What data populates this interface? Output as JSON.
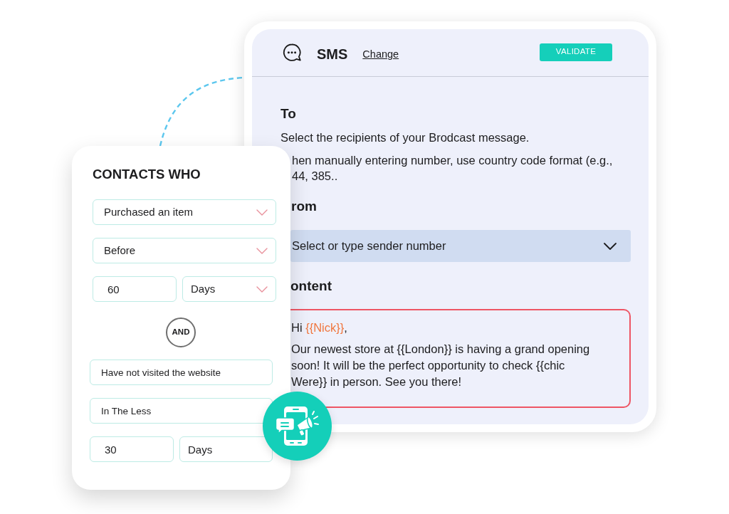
{
  "sms_panel": {
    "header": {
      "title": "SMS",
      "link": "Change",
      "button": "VALIDATE"
    },
    "to": {
      "heading": "To",
      "description": "Select the recipients of your Brodcast message.",
      "note": "hen manually entering number, use country code format (e.g., 44, 385.."
    },
    "from": {
      "heading": "rom",
      "sender_select": {
        "placeholder": "Select or type sender number"
      }
    },
    "content": {
      "heading": "ontent",
      "greeting": [
        {
          "kind": "text",
          "text": "Hi "
        },
        {
          "kind": "variable",
          "text": "{{Nick}}"
        },
        {
          "kind": "text",
          "text": ","
        }
      ],
      "body": "Our newest store at {{London}} is having a grand opening soon! It will be the perfect opportunity to check {{chic Were}} in person. See you there!"
    }
  },
  "contacts_card": {
    "title": "CONTACTS WHO",
    "condition_groups": [
      {
        "rows": [
          [
            {
              "kind": "dropdown",
              "value": "Purchased an item"
            }
          ],
          [
            {
              "kind": "dropdown",
              "value": "Before"
            }
          ],
          [
            {
              "kind": "field",
              "value": "60"
            },
            {
              "kind": "dropdown",
              "value": "Days"
            }
          ]
        ]
      },
      {
        "rows": [
          [
            {
              "kind": "field",
              "value": "Have not visited the website"
            }
          ],
          [
            {
              "kind": "field",
              "value": "In The Less"
            }
          ],
          [
            {
              "kind": "field",
              "value": "30"
            },
            {
              "kind": "field",
              "value": "Days"
            }
          ]
        ]
      }
    ],
    "operator": "AND"
  }
}
